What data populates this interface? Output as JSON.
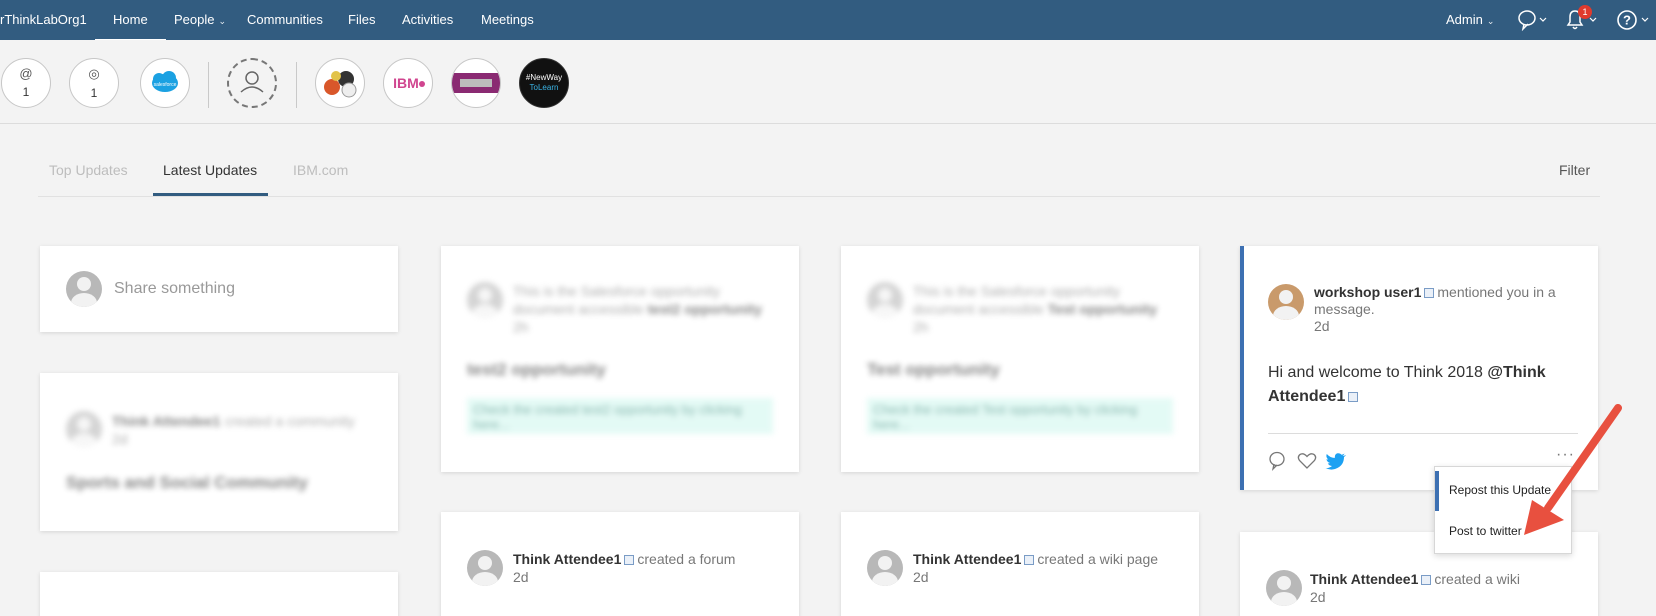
{
  "nav": {
    "org": "rThinkLabOrg1",
    "items": [
      {
        "label": "Home",
        "active": true
      },
      {
        "label": "People",
        "dropdown": true
      },
      {
        "label": "Communities"
      },
      {
        "label": "Files"
      },
      {
        "label": "Activities"
      },
      {
        "label": "Meetings"
      }
    ],
    "user_label": "Admin",
    "notification_count": "1",
    "icons": [
      "chat-bubble-icon",
      "bell-icon",
      "help-icon"
    ]
  },
  "bubbles": [
    {
      "icon": "@",
      "count": "1"
    },
    {
      "icon": "◎",
      "count": "1"
    },
    {
      "icon": "salesforce"
    },
    {
      "icon": "person-placeholder"
    },
    {
      "icon": "sports-balls"
    },
    {
      "icon": "IBM"
    },
    {
      "icon": "community-photo"
    },
    {
      "icon": "#NewWay ToLearn"
    }
  ],
  "tabs": [
    {
      "label": "Top Updates"
    },
    {
      "label": "Latest Updates",
      "active": true
    },
    {
      "label": "IBM.com"
    }
  ],
  "filter_label": "Filter",
  "share_placeholder": "Share something",
  "cards": {
    "community": {
      "name": "Think Attendee1",
      "action": "created a community",
      "age": "2d",
      "title": "Sports and Social Community"
    },
    "opp1": {
      "text": "This is the Salesforce opportunity document accessible",
      "bold": "test2 opportunity",
      "age": "2h",
      "title": "test2 opportunity",
      "green": "Check the created test2 opportunity by clicking here..."
    },
    "opp2": {
      "text": "This is the Salesforce opportunity document accessible",
      "bold": "Test opportunity",
      "age": "2h",
      "title": "Test opportunity",
      "green": "Check the created Test opportunity by clicking here..."
    },
    "featured": {
      "name": "workshop user1",
      "action": "mentioned you in a message.",
      "age": "2d",
      "text": "Hi and welcome to Think 2018",
      "mention": "@Think Attendee1"
    },
    "forum": {
      "name": "Think Attendee1",
      "action": "created a forum",
      "age": "2d"
    },
    "wikipage": {
      "name": "Think Attendee1",
      "action": "created a wiki page",
      "age": "2d"
    },
    "wiki": {
      "name": "Think Attendee1",
      "action": "created a wiki",
      "age": "2d"
    }
  },
  "menu": {
    "items": [
      {
        "label": "Repost this Update"
      },
      {
        "label": "Post to twitter"
      }
    ]
  },
  "colors": {
    "nav_bg": "#325c80",
    "accent": "#3d70b2",
    "arrow": "#e8503f",
    "twitter": "#1da1f2"
  }
}
